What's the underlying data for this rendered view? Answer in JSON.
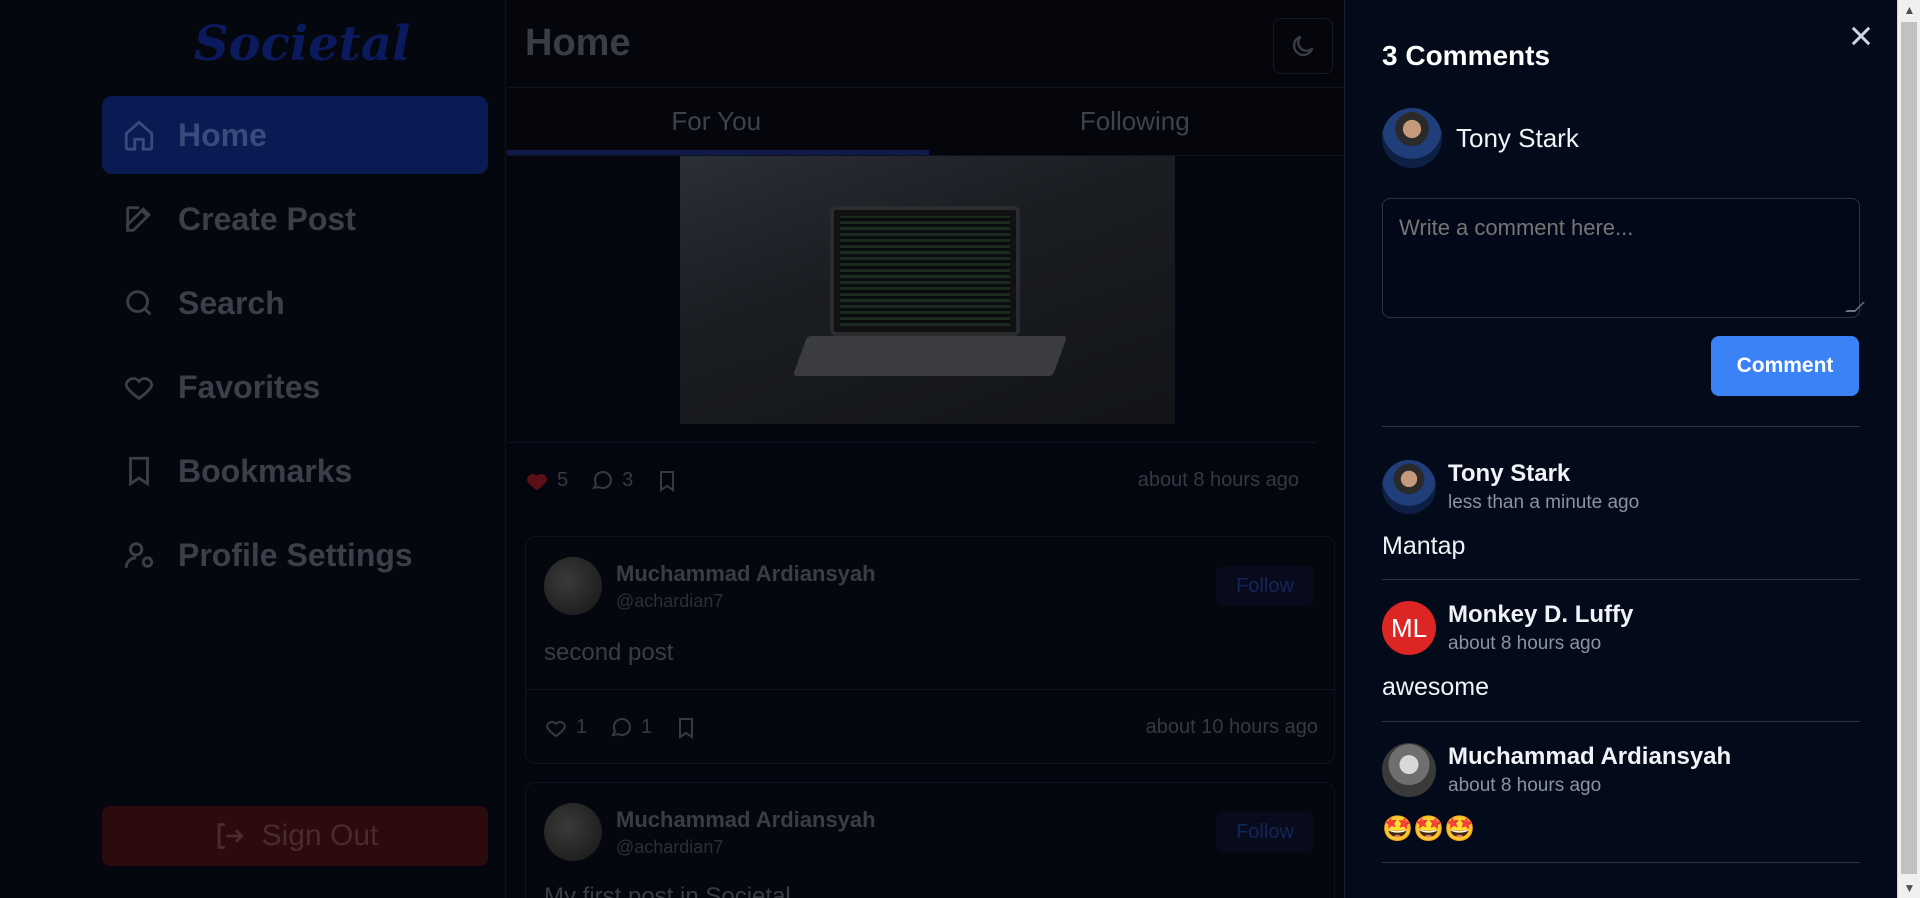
{
  "sidebar": {
    "logo": "Societal",
    "items": [
      {
        "label": "Home",
        "icon": "home-icon",
        "active": true
      },
      {
        "label": "Create Post",
        "icon": "edit-icon",
        "active": false
      },
      {
        "label": "Search",
        "icon": "search-icon",
        "active": false
      },
      {
        "label": "Favorites",
        "icon": "heart-icon",
        "active": false
      },
      {
        "label": "Bookmarks",
        "icon": "bookmark-icon",
        "active": false
      },
      {
        "label": "Profile Settings",
        "icon": "user-settings-icon",
        "active": false
      }
    ],
    "signout_label": "Sign Out"
  },
  "feed": {
    "title": "Home",
    "tabs": [
      {
        "label": "For You",
        "active": true
      },
      {
        "label": "Following",
        "active": false
      }
    ],
    "posts": [
      {
        "likes": "5",
        "comments": "3",
        "time": "about 8 hours ago",
        "liked": true
      },
      {
        "author": "Muchammad Ardiansyah",
        "handle": "@achardian7",
        "follow_label": "Follow",
        "text": "second post",
        "likes": "1",
        "comments": "1",
        "time": "about 10 hours ago",
        "liked": false
      },
      {
        "author": "Muchammad Ardiansyah",
        "handle": "@achardian7",
        "follow_label": "Follow",
        "text": "My first post in Societal"
      }
    ]
  },
  "drawer": {
    "title": "3 Comments",
    "current_user": "Tony Stark",
    "input_placeholder": "Write a comment here...",
    "submit_label": "Comment",
    "comments": [
      {
        "author": "Tony Stark",
        "time": "less than a minute ago",
        "text": "Mantap"
      },
      {
        "author": "Monkey D. Luffy",
        "initials": "ML",
        "time": "about 8 hours ago",
        "text": "awesome"
      },
      {
        "author": "Muchammad Ardiansyah",
        "time": "about 8 hours ago",
        "text": "🤩🤩🤩"
      }
    ]
  },
  "colors": {
    "accent": "#3b82f6",
    "initials_avatar": "#dc2626",
    "drawer_bg": "#030a1a"
  }
}
